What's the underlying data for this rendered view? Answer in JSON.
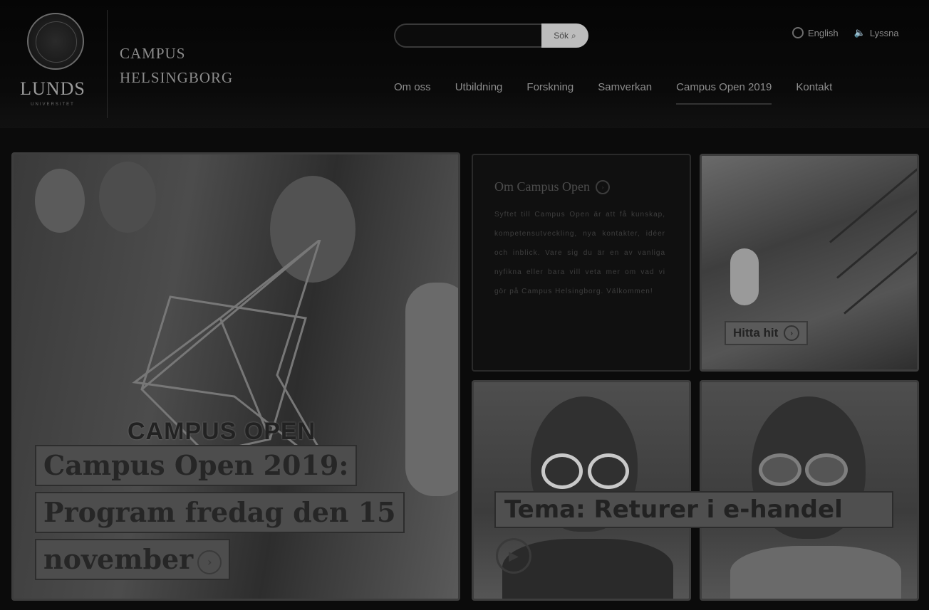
{
  "logo": {
    "word": "LUNDS",
    "sub": "UNIVERSITET"
  },
  "site_title": {
    "line1": "CAMPUS",
    "line2": "HELSINGBORG"
  },
  "search": {
    "placeholder": "",
    "button_label": "Sök"
  },
  "top_links": [
    {
      "label": "English",
      "icon": "globe-icon"
    },
    {
      "label": "Lyssna",
      "icon": "speaker-icon"
    }
  ],
  "nav": [
    {
      "label": "Om oss"
    },
    {
      "label": "Utbildning"
    },
    {
      "label": "Forskning"
    },
    {
      "label": "Samverkan"
    },
    {
      "label": "Campus Open 2019",
      "active": true
    },
    {
      "label": "Kontakt"
    }
  ],
  "hero": {
    "brand_text": "CAMPUS OPEN",
    "line1": "Campus Open 2019:",
    "line2": "Program fredag den 15",
    "line3": "november",
    "arrow_icon": "arrow-right-circle-icon"
  },
  "info": {
    "title": "Om Campus Open",
    "body": "Syftet till Campus Open är att få kunskap, kompetensutveckling, nya kontakter, idéer och inblick. Vare sig du är en av vanliga nyfikna eller bara vill veta mer om vad vi gör på Campus Helsingborg. Välkommen!"
  },
  "find_here": {
    "label": "Hitta hit"
  },
  "tema": {
    "label": "Tema: Returer i e-handel",
    "play_icon": "play-icon"
  }
}
